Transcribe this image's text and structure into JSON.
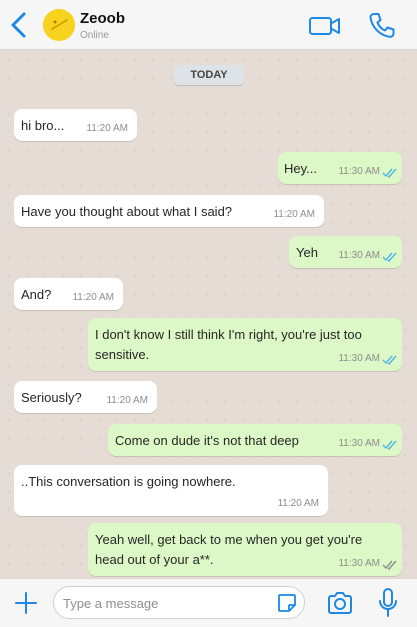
{
  "colors": {
    "accent": "#1e88e5",
    "chat_background": "#e5ddd5",
    "incoming_bubble": "#ffffff",
    "outgoing_bubble": "#dcf8c6",
    "read_tick": "#4fb3e8",
    "avatar": "#f7d21e"
  },
  "header": {
    "back_icon": "chevron-left-icon",
    "contact_name": "Zeoob",
    "status": "Online",
    "video_icon": "video-camera-icon",
    "phone_icon": "phone-icon"
  },
  "chat": {
    "date_label": "TODAY",
    "messages": [
      {
        "direction": "in",
        "text": "hi bro...",
        "time": "11:20 AM"
      },
      {
        "direction": "out",
        "text": "Hey...",
        "time": "11:30 AM",
        "status": "read"
      },
      {
        "direction": "in",
        "text": "Have you thought about what I said?",
        "time": "11:20 AM"
      },
      {
        "direction": "out",
        "text": "Yeh",
        "time": "11:30 AM",
        "status": "read"
      },
      {
        "direction": "in",
        "text": "And?",
        "time": "11:20 AM"
      },
      {
        "direction": "out",
        "text": "I don't know I still think I'm right, you're just too sensitive.",
        "time": "11:30 AM",
        "status": "read"
      },
      {
        "direction": "in",
        "text": "Seriously?",
        "time": "11:20 AM"
      },
      {
        "direction": "out",
        "text": "Come on dude it's not that deep",
        "time": "11:30 AM",
        "status": "read"
      },
      {
        "direction": "in",
        "text": "..This conversation is going nowhere.",
        "time": "11:20 AM"
      },
      {
        "direction": "out",
        "text": "Yeah well, get back to me when you get you're head out of your a**.",
        "time": "11:30 AM",
        "status": "delivered"
      }
    ]
  },
  "input_bar": {
    "placeholder": "Type a message",
    "plus_icon": "plus-icon",
    "sticker_icon": "sticker-icon",
    "camera_icon": "camera-icon",
    "mic_icon": "microphone-icon"
  }
}
